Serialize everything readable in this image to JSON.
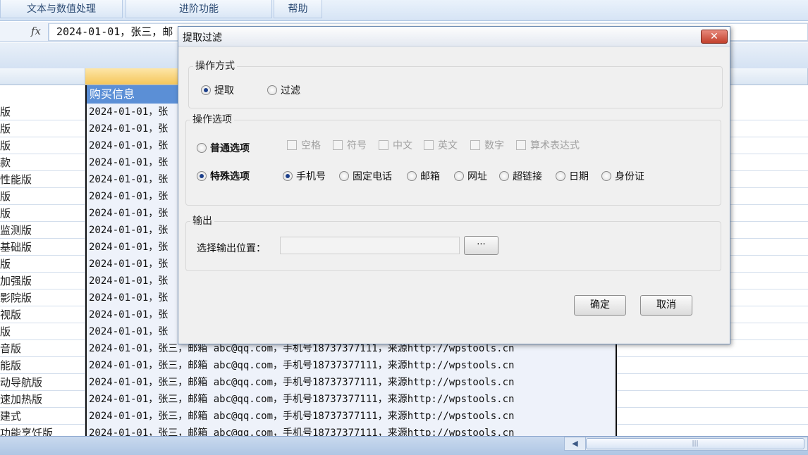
{
  "ribbon": {
    "tabs": [
      "文本与数值处理",
      "进阶功能",
      "帮助"
    ]
  },
  "formula_bar": {
    "fx_label": "fx",
    "value": "2024-01-01，张三，邮"
  },
  "sheet": {
    "header_b": "购买信息",
    "row_text": "2024-01-01，张三，邮箱 abc@qq.com，手机号18737377111，来源http://wpstools.cn",
    "row_text_partial": "2024-01-01，张",
    "col_a": [
      "版",
      "版",
      "版",
      "款",
      "性能版",
      "版",
      "版",
      "监测版",
      "基础版",
      "版",
      "加强版",
      "影院版",
      "视版",
      "版",
      "音版",
      "能版",
      "动导航版",
      "速加热版",
      "建式",
      "功能烹饪版"
    ]
  },
  "scrollbar": {
    "left_arrow": "◀",
    "thumb_grip": "|||"
  },
  "dialog": {
    "title": "提取过滤",
    "close_glyph": "✕",
    "mode": {
      "legend": "操作方式",
      "options": [
        {
          "label": "提取",
          "selected": true
        },
        {
          "label": "过滤",
          "selected": false
        }
      ]
    },
    "options": {
      "legend": "操作选项",
      "normal_label": "普通选项",
      "normal_selected": false,
      "normal_checkboxes": [
        "空格",
        "符号",
        "中文",
        "英文",
        "数字",
        "算术表达式"
      ],
      "special_label": "特殊选项",
      "special_selected": true,
      "special_radios": [
        {
          "label": "手机号",
          "selected": true
        },
        {
          "label": "固定电话",
          "selected": false
        },
        {
          "label": "邮箱",
          "selected": false
        },
        {
          "label": "网址",
          "selected": false
        },
        {
          "label": "超链接",
          "selected": false
        },
        {
          "label": "日期",
          "selected": false
        },
        {
          "label": "身份证",
          "selected": false
        }
      ]
    },
    "output": {
      "legend": "输出",
      "location_label": "选择输出位置：",
      "location_value": "",
      "browse_label": "···"
    },
    "ok_label": "确定",
    "cancel_label": "取消"
  }
}
